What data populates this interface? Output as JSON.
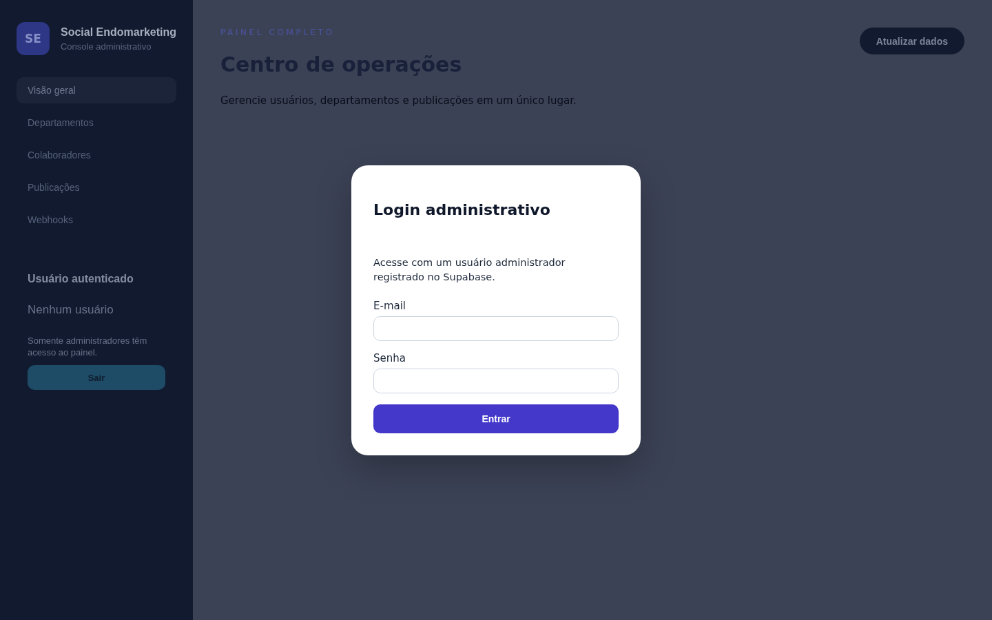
{
  "sidebar": {
    "logo": "SE",
    "title": "Social Endomarketing",
    "subtitle": "Console administrativo",
    "nav": [
      {
        "label": "Visão geral",
        "selected": true
      },
      {
        "label": "Departamentos",
        "selected": false
      },
      {
        "label": "Colaboradores",
        "selected": false
      },
      {
        "label": "Publicações",
        "selected": false
      },
      {
        "label": "Webhooks",
        "selected": false
      }
    ],
    "user": {
      "heading": "Usuário autenticado",
      "name": "Nenhum usuário",
      "note": "Somente administradores têm acesso ao painel.",
      "button": "Sair"
    }
  },
  "header": {
    "eyebrow": "PAINEL COMPLETO",
    "title": "Centro de operações",
    "description": "Gerencie usuários, departamentos e publicações em um único lugar.",
    "button": "Atualizar dados"
  },
  "modal": {
    "title": "Login administrativo",
    "description": "Acesse com um usuário administrador registrado no Supabase.",
    "fields": [
      {
        "label": "E-mail"
      },
      {
        "label": "Senha"
      }
    ],
    "button": "Entrar"
  }
}
